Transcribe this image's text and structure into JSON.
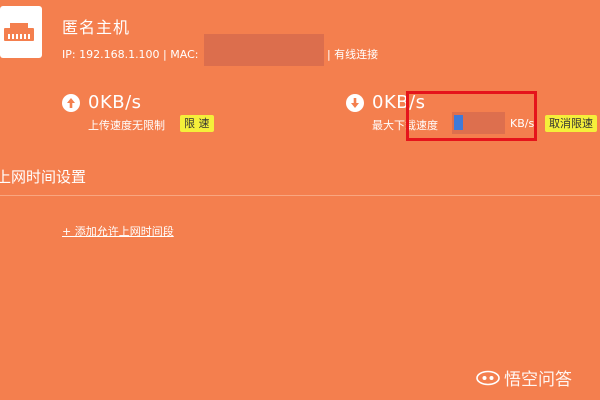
{
  "device": {
    "name": "匿名主机",
    "ip_label": "IP: 192.168.1.100 | MAC: ",
    "connection": "| 有线连接"
  },
  "upload": {
    "speed": "0KB/s",
    "status": "上传速度无限制",
    "button": "限 速"
  },
  "download": {
    "speed": "0KB/s",
    "limit_label": "最大下载速度",
    "limit_value": "0",
    "unit": "KB/s",
    "button": "取消限速"
  },
  "online_time": {
    "title": "上网时间设置",
    "add_link": "+ 添加允许上网时间段"
  },
  "watermark": {
    "text": "悟空问答"
  },
  "colors": {
    "background": "#f47f4e",
    "button_yellow": "#f5ef3a",
    "highlight_red": "#e5141b"
  },
  "icons": {
    "device": "ethernet-port-icon",
    "upload": "arrow-up-circle-icon",
    "download": "arrow-down-circle-icon",
    "watermark": "wukong-logo-icon"
  }
}
